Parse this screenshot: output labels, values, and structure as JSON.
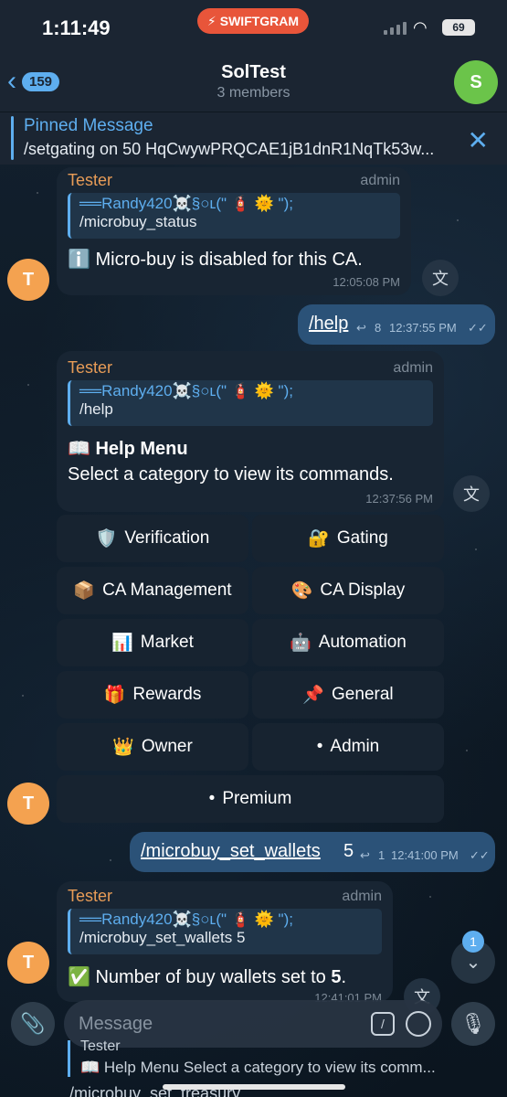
{
  "status_bar": {
    "time": "1:11:49",
    "app_badge": "SWIFTGRAM",
    "battery": "69"
  },
  "header": {
    "back_count": "159",
    "title": "SolTest",
    "subtitle": "3 members",
    "avatar_letter": "S"
  },
  "pinned": {
    "title": "Pinned Message",
    "text": "/setgating on 50 HqCwywPRQCAE1jB1dnR1NqTk53w..."
  },
  "messages": [
    {
      "sender": "Tester",
      "role": "admin",
      "reply_name": "══Randy420☠️§○ʟ(\" 🧯 🌞 \");",
      "reply_text": "/microbuy_status",
      "text": "ℹ️ Micro-buy is disabled for this CA.",
      "time": "12:05:08 PM",
      "avatar": "T"
    },
    {
      "outgoing": true,
      "text": "/help",
      "replies": "8",
      "time": "12:37:55 PM"
    },
    {
      "sender": "Tester",
      "role": "admin",
      "reply_name": "══Randy420☠️§○ʟ(\" 🧯 🌞 \");",
      "reply_text": "/help",
      "title": "📖 Help Menu",
      "text": "Select a category to view its commands.",
      "time": "12:37:56 PM",
      "avatar": "T",
      "buttons": [
        {
          "icon": "🛡️",
          "label": "Verification"
        },
        {
          "icon": "🔐",
          "label": "Gating"
        },
        {
          "icon": "📦",
          "label": "CA Management"
        },
        {
          "icon": "🎨",
          "label": "CA Display"
        },
        {
          "icon": "📊",
          "label": "Market"
        },
        {
          "icon": "🤖",
          "label": "Automation"
        },
        {
          "icon": "🎁",
          "label": "Rewards"
        },
        {
          "icon": "📌",
          "label": "General"
        },
        {
          "icon": "👑",
          "label": "Owner"
        },
        {
          "icon": "•",
          "label": "Admin"
        },
        {
          "icon": "•",
          "label": "Premium"
        }
      ]
    },
    {
      "outgoing": true,
      "text": "/microbuy_set_wallets",
      "suffix": "5",
      "replies": "1",
      "time": "12:41:00 PM"
    },
    {
      "sender": "Tester",
      "role": "admin",
      "reply_name": "══Randy420☠️§○ʟ(\" 🧯 🌞 \");",
      "reply_text": "/microbuy_set_wallets 5",
      "text_prefix": "✅ Number of buy wallets set to ",
      "text_bold": "5",
      "text_suffix": ".",
      "time": "12:41:01 PM",
      "avatar": "T"
    }
  ],
  "scroll_down_badge": "1",
  "composer": {
    "placeholder": "Message"
  },
  "reply_preview": {
    "name": "Tester",
    "text": "📖 Help Menu Select a category to view its comm..."
  },
  "bottom_text": "/microbuy_set_treasury"
}
